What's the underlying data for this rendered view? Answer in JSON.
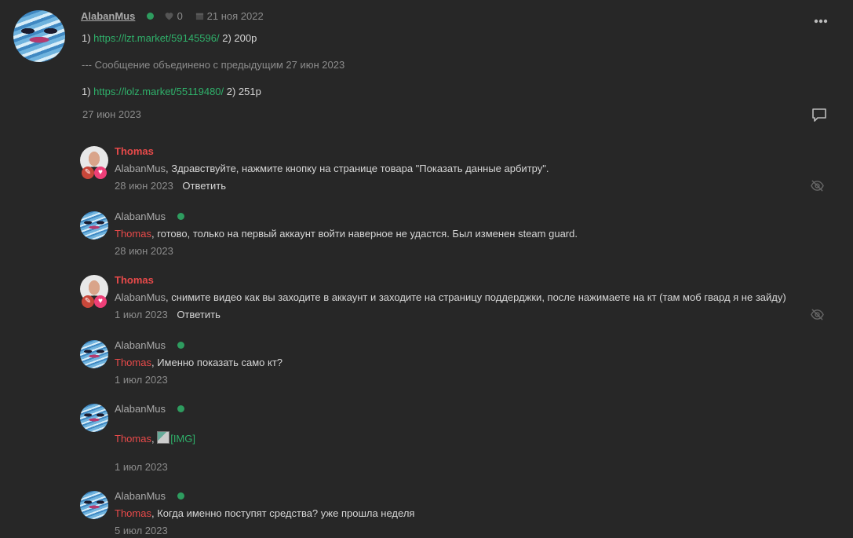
{
  "post": {
    "author": "AlabanMus",
    "likes": "0",
    "date": "21 ноя 2022",
    "line1_prefix": "1) ",
    "line1_link": "https://lzt.market/59145596/",
    "line1_suffix": " 2) 200р",
    "merged_note": "--- Сообщение объединено с предыдущим 27 июн 2023",
    "line2_prefix": "1) ",
    "line2_link": "https://lolz.market/55119480/",
    "line2_suffix": " 2) 251р",
    "footer_date": "27 июн 2023"
  },
  "comments": [
    {
      "author": "Thomas",
      "mention": "AlabanMus",
      "text": ", Здравствуйте, нажмите кнопку на странице товара \"Показать данные арбитру\".",
      "date": "28 июн 2023",
      "reply": "Ответить"
    },
    {
      "author": "AlabanMus",
      "mention": "Thomas",
      "text": ", готово, только на первый аккаунт войти наверное не удастся. Был изменен steam guard.",
      "date": "28 июн 2023"
    },
    {
      "author": "Thomas",
      "mention": "AlabanMus",
      "text": ", снимите видео как вы заходите в аккаунт и заходите на страницу поддерджки, после нажимаете на кт (там моб гвард я не зайду)",
      "date": "1 июл 2023",
      "reply": "Ответить"
    },
    {
      "author": "AlabanMus",
      "mention": "Thomas",
      "text": ", Именно показать само кт?",
      "date": "1 июл 2023"
    },
    {
      "author": "AlabanMus",
      "mention": "Thomas",
      "text": ", ",
      "img_text": "[IMG]",
      "date": "1 июл 2023"
    },
    {
      "author": "AlabanMus",
      "mention": "Thomas",
      "text": ", Когда именно поступят средства? уже прошла неделя",
      "date": "5 июл 2023"
    }
  ],
  "icons": {
    "heart": "heart-icon",
    "calendar": "calendar-icon",
    "more": "more-icon",
    "comment": "comment-icon",
    "hidden": "eye-off-icon"
  },
  "colors": {
    "background": "#272727",
    "link": "#2fb06a",
    "thomas": "#e84a4a",
    "online": "#2e9c5f"
  }
}
